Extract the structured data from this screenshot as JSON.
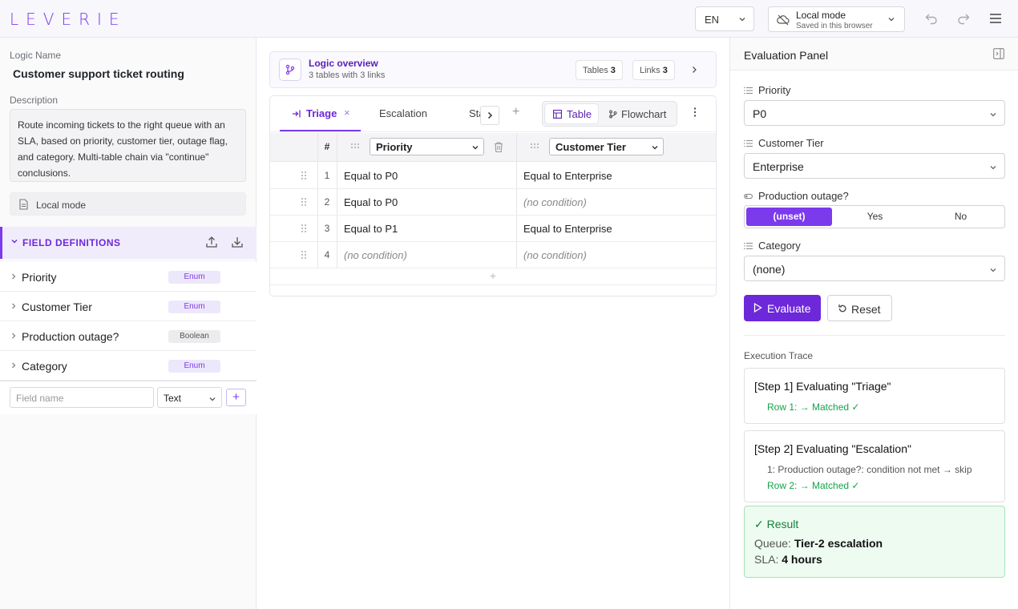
{
  "app": {
    "logo": "LEVERIE",
    "language": "EN",
    "mode_title": "Local mode",
    "mode_subtitle": "Saved in this browser"
  },
  "sidebar": {
    "logic_name_label": "Logic Name",
    "logic_name": "Customer support ticket routing",
    "description_label": "Description",
    "description": "Route incoming tickets to the right queue with an SLA, based on priority, customer tier, outage flag, and category. Multi-table chain via \"continue\" conclusions.",
    "local_mode": "Local mode",
    "field_definitions_title": "FIELD DEFINITIONS",
    "fields": [
      {
        "name": "Priority",
        "type": "Enum"
      },
      {
        "name": "Customer Tier",
        "type": "Enum"
      },
      {
        "name": "Production outage?",
        "type": "Boolean"
      },
      {
        "name": "Category",
        "type": "Enum"
      }
    ],
    "new_field_placeholder": "Field name",
    "new_field_type": "Text",
    "add_symbol": "+"
  },
  "overview": {
    "title": "Logic overview",
    "subtitle": "3 tables with 3 links",
    "tables_label": "Tables",
    "tables_count": "3",
    "links_label": "Links",
    "links_count": "3"
  },
  "editor": {
    "tabs": [
      "Triage",
      "Escalation",
      "Sta"
    ],
    "tab_close": "×",
    "add_tab": "+",
    "view_table": "Table",
    "view_flowchart": "Flowchart",
    "hash_header": "#",
    "columns": [
      "Priority",
      "Customer Tier"
    ],
    "rows": [
      {
        "num": "1",
        "c1": "Equal to P0",
        "c2": "Equal to Enterprise"
      },
      {
        "num": "2",
        "c1": "Equal to P0",
        "c2": "(no condition)"
      },
      {
        "num": "3",
        "c1": "Equal to P1",
        "c2": "Equal to Enterprise"
      },
      {
        "num": "4",
        "c1": "(no condition)",
        "c2": "(no condition)"
      }
    ],
    "add_row": "+"
  },
  "evaluation": {
    "title": "Evaluation Panel",
    "priority_label": "Priority",
    "priority_value": "P0",
    "tier_label": "Customer Tier",
    "tier_value": "Enterprise",
    "outage_label": "Production outage?",
    "outage_options": [
      "(unset)",
      "Yes",
      "No"
    ],
    "outage_selected": "(unset)",
    "category_label": "Category",
    "category_value": "(none)",
    "evaluate_button": "Evaluate",
    "reset_button": "Reset",
    "trace_label": "Execution Trace",
    "steps": [
      {
        "header": "[Step 1] Evaluating \"Triage\"",
        "lines": [
          "Row 1: → Matched ✓"
        ]
      },
      {
        "header": "[Step 2] Evaluating \"Escalation\"",
        "lines": [
          "1: Production outage?: condition not met → skip",
          "Row 2: → Matched ✓"
        ]
      }
    ],
    "result": {
      "header": "✓ Result",
      "queue_label": "Queue:",
      "queue_value": "Tier-2 escalation",
      "sla_label": "SLA:",
      "sla_value": "4 hours"
    },
    "colors": {
      "accent": "#7c3aed",
      "success": "#16a34a",
      "result_bg": "#eefbf1"
    }
  }
}
